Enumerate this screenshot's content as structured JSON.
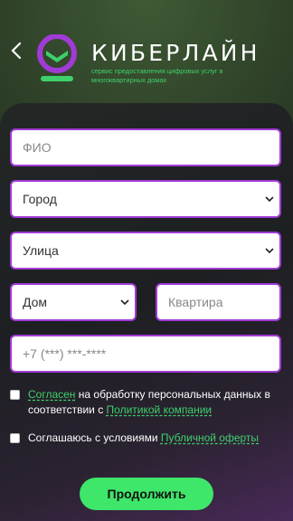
{
  "header": {
    "back_icon": "chevron-left-icon",
    "brand_name": "КИБЕРЛАЙН",
    "tagline": "сервис предоставления цифровых услуг в многоквартирных домах"
  },
  "colors": {
    "accent_green": "#3ed06a",
    "accent_purple": "#a13bd6"
  },
  "form": {
    "name_placeholder": "ФИО",
    "city_select": "Город",
    "street_select": "Улица",
    "house_select": "Дом",
    "apartment_placeholder": "Квартира",
    "phone_placeholder": "+7 (***) ***-****"
  },
  "consent": {
    "personal_data": {
      "link1": "Согласен",
      "text1": " на обработку персональных данных в соответствии с ",
      "link2": "Политикой компании"
    },
    "offer": {
      "text1": "Соглашаюсь с условиями ",
      "link1": "Публичной оферты"
    }
  },
  "submit_label": "Продолжить"
}
